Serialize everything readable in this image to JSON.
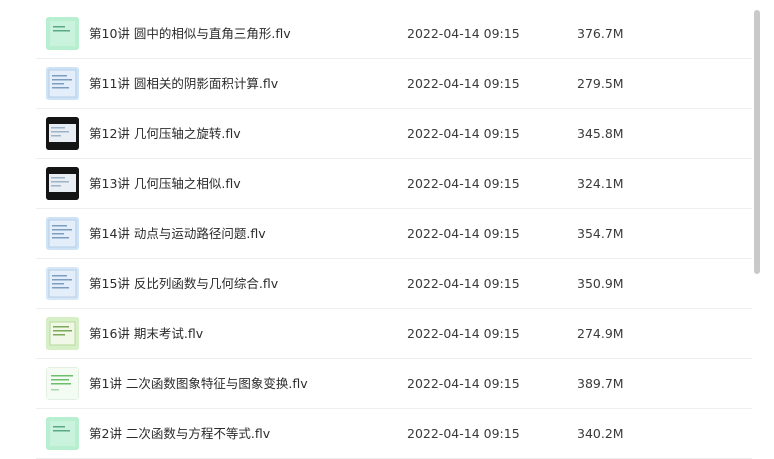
{
  "files": [
    {
      "name": "第10讲 圆中的相似与直角三角形.flv",
      "modified": "2022-04-14 09:15",
      "size": "376.7M",
      "thumb_icon": "video-thumbnail-icon",
      "thumb_color": "#b8efd0"
    },
    {
      "name": "第11讲 圆相关的阴影面积计算.flv",
      "modified": "2022-04-14 09:15",
      "size": "279.5M",
      "thumb_icon": "video-thumbnail-icon",
      "thumb_color": "#cfe3f7"
    },
    {
      "name": "第12讲 几何压轴之旋转.flv",
      "modified": "2022-04-14 09:15",
      "size": "345.8M",
      "thumb_icon": "video-thumbnail-icon",
      "thumb_color": "#1a1a1a"
    },
    {
      "name": "第13讲 几何压轴之相似.flv",
      "modified": "2022-04-14 09:15",
      "size": "324.1M",
      "thumb_icon": "video-thumbnail-icon",
      "thumb_color": "#1a1a1a"
    },
    {
      "name": "第14讲 动点与运动路径问题.flv",
      "modified": "2022-04-14 09:15",
      "size": "354.7M",
      "thumb_icon": "video-thumbnail-icon",
      "thumb_color": "#cfe3f7"
    },
    {
      "name": "第15讲 反比列函数与几何综合.flv",
      "modified": "2022-04-14 09:15",
      "size": "350.9M",
      "thumb_icon": "video-thumbnail-icon",
      "thumb_color": "#d7e7f7"
    },
    {
      "name": "第16讲 期末考试.flv",
      "modified": "2022-04-14 09:15",
      "size": "274.9M",
      "thumb_icon": "video-thumbnail-icon",
      "thumb_color": "#d6efc6"
    },
    {
      "name": "第1讲 二次函数图象特征与图象变换.flv",
      "modified": "2022-04-14 09:15",
      "size": "389.7M",
      "thumb_icon": "video-thumbnail-icon",
      "thumb_color": "#f2fbf2"
    },
    {
      "name": "第2讲 二次函数与方程不等式.flv",
      "modified": "2022-04-14 09:15",
      "size": "340.2M",
      "thumb_icon": "video-thumbnail-icon",
      "thumb_color": "#b8efd0"
    }
  ]
}
